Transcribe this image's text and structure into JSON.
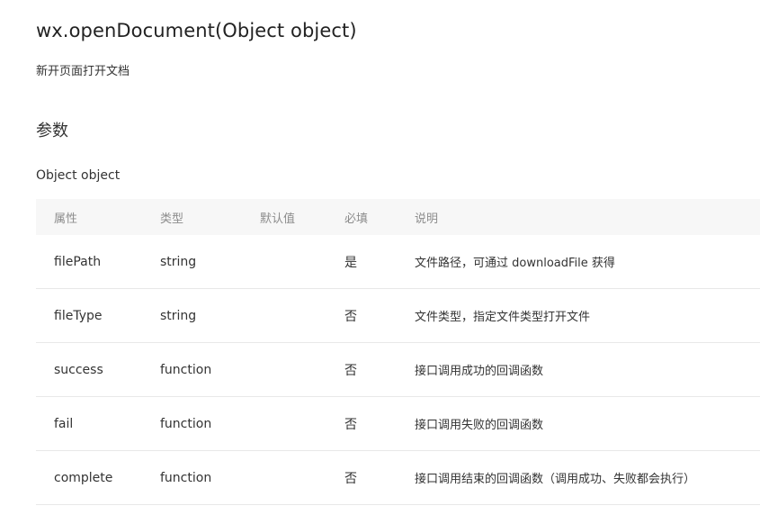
{
  "header": {
    "title": "wx.openDocument(Object object)",
    "description": "新开页面打开文档"
  },
  "params_section": {
    "title": "参数",
    "object_label": "Object object"
  },
  "table": {
    "headers": [
      "属性",
      "类型",
      "默认值",
      "必填",
      "说明"
    ],
    "rows": [
      [
        "filePath",
        "string",
        "",
        "是",
        "文件路径，可通过 downloadFile 获得"
      ],
      [
        "fileType",
        "string",
        "",
        "否",
        "文件类型，指定文件类型打开文件"
      ],
      [
        "success",
        "function",
        "",
        "否",
        "接口调用成功的回调函数"
      ],
      [
        "fail",
        "function",
        "",
        "否",
        "接口调用失败的回调函数"
      ],
      [
        "complete",
        "function",
        "",
        "否",
        "接口调用结束的回调函数（调用成功、失败都会执行）"
      ]
    ]
  }
}
